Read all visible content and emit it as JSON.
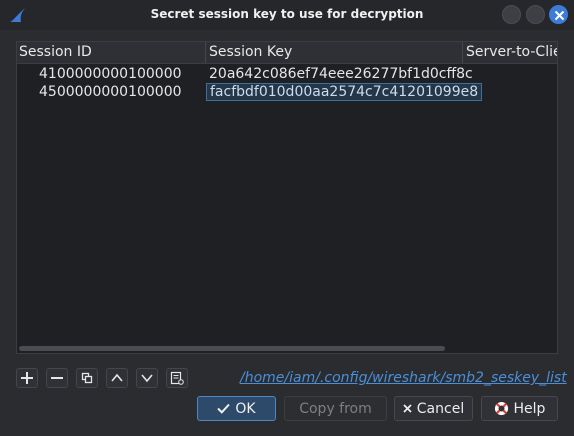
{
  "window": {
    "title": "Secret session key to use for decryption",
    "icon": "shark-fin-icon"
  },
  "table": {
    "columns": [
      "Session ID",
      "Session Key",
      "Server-to-Clie"
    ],
    "rows": [
      {
        "session_id": "4100000000100000",
        "session_key": "20a642c086ef74eee26277bf1d0cff8c"
      },
      {
        "session_id": "4500000000100000",
        "session_key": "facfbdf010d00aa2574c7c41201099e8"
      }
    ],
    "selected_row": 1
  },
  "toolbar": {
    "icons": [
      "add-icon",
      "remove-icon",
      "copy-icon",
      "move-up-icon",
      "move-down-icon",
      "clear-icon"
    ]
  },
  "file_link": "/home/iam/.config/wireshark/smb2_seskey_list",
  "buttons": {
    "ok": "OK",
    "copy_from": "Copy from",
    "cancel": "Cancel",
    "help": "Help"
  },
  "colors": {
    "accent": "#3d7bd9",
    "link": "#4a8fd8",
    "background": "#2a2c30"
  }
}
